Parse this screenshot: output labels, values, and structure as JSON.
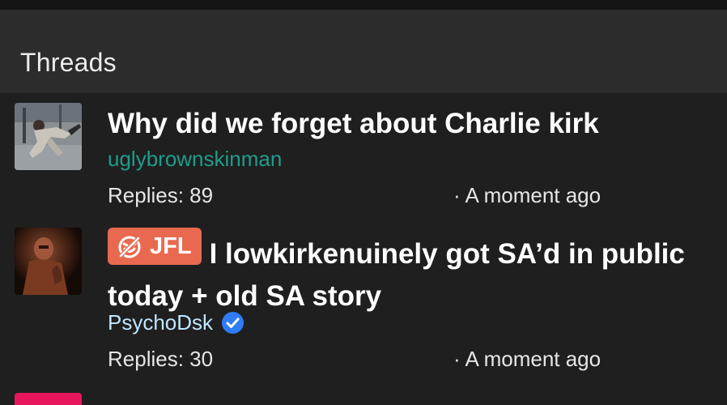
{
  "header": {
    "title": "Threads"
  },
  "threads": [
    {
      "title": "Why did we forget about Charlie kirk",
      "author": "uglybrownskinman",
      "replies": "Replies: 89",
      "time": "· A moment ago",
      "author_color": "#1f9d8a"
    },
    {
      "tag": {
        "label": "JFL",
        "icon": "laugh-icon",
        "color": "#e8694f"
      },
      "title": "I lowkirkenuinely got SA’d in public today + old SA story",
      "author": "PsychoDsk",
      "verified": true,
      "replies": "Replies: 30",
      "time": "· A moment ago",
      "author_color": "#bfe6ff"
    },
    {
      "title": "",
      "avatar_color": "#e8175d"
    }
  ],
  "colors": {
    "background": "#1f1f1f",
    "header_bg": "#2c2c2c",
    "verified": "#2e7cf6"
  }
}
